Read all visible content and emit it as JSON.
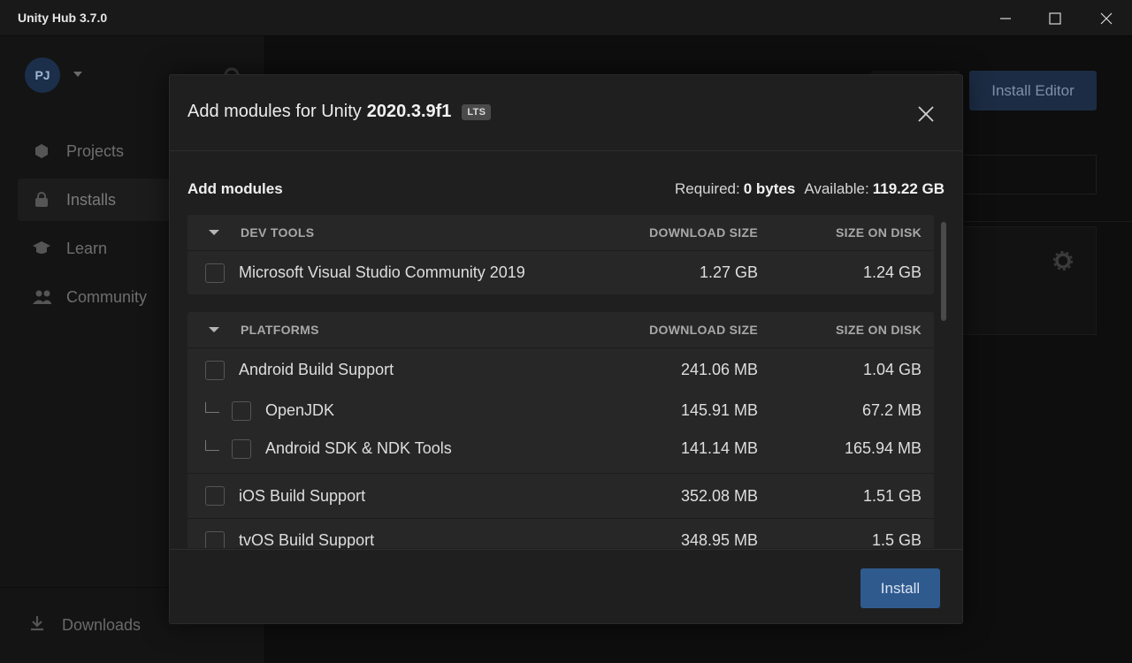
{
  "window": {
    "title": "Unity Hub 3.7.0"
  },
  "sidebar": {
    "avatar_initials": "PJ",
    "items": [
      {
        "label": "Projects",
        "icon": "cube-icon"
      },
      {
        "label": "Installs",
        "icon": "lock-icon"
      },
      {
        "label": "Learn",
        "icon": "graduation-cap-icon"
      },
      {
        "label": "Community",
        "icon": "people-icon"
      }
    ],
    "downloads_label": "Downloads"
  },
  "background": {
    "install_editor_label": "Install Editor"
  },
  "modal": {
    "title_prefix": "Add modules for Unity",
    "version": "2020.3.9f1",
    "badge": "LTS",
    "subtitle": "Add modules",
    "required_label": "Required:",
    "required_value": "0 bytes",
    "available_label": "Available:",
    "available_value": "119.22 GB",
    "install_label": "Install"
  },
  "sections": [
    {
      "name": "DEV TOOLS",
      "col_download": "DOWNLOAD SIZE",
      "col_disk": "SIZE ON DISK",
      "rows": [
        {
          "label": "Microsoft Visual Studio Community 2019",
          "download": "1.27 GB",
          "disk": "1.24 GB"
        }
      ]
    },
    {
      "name": "PLATFORMS",
      "col_download": "DOWNLOAD SIZE",
      "col_disk": "SIZE ON DISK",
      "rows": [
        {
          "label": "Android Build Support",
          "download": "241.06 MB",
          "disk": "1.04 GB"
        },
        {
          "label": "OpenJDK",
          "download": "145.91 MB",
          "disk": "67.2 MB"
        },
        {
          "label": "Android SDK & NDK Tools",
          "download": "141.14 MB",
          "disk": "165.94 MB"
        },
        {
          "label": "iOS Build Support",
          "download": "352.08 MB",
          "disk": "1.51 GB"
        },
        {
          "label": "tvOS Build Support",
          "download": "348.95 MB",
          "disk": "1.5 GB"
        }
      ]
    }
  ]
}
